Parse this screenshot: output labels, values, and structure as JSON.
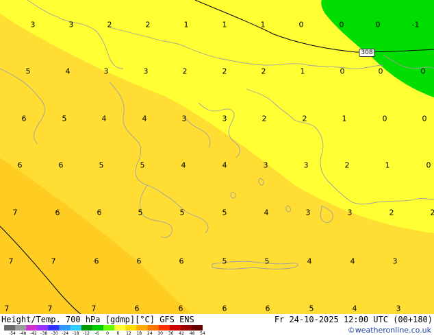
{
  "map": {
    "contour_label": "308",
    "colors": {
      "land_sea": "#ffff33",
      "warm_zone": "#ffdd33",
      "warmer_zone": "#ffcc22",
      "cold_zone": "#00dd00",
      "coastline": "#a0a0a0"
    },
    "temps": [
      "3",
      "3",
      "2",
      "2",
      "1",
      "1",
      "1",
      "0",
      "0",
      "0",
      "-1",
      "5",
      "4",
      "3",
      "3",
      "2",
      "2",
      "2",
      "1",
      "0",
      "0",
      "0",
      "6",
      "5",
      "4",
      "4",
      "3",
      "3",
      "2",
      "2",
      "1",
      "0",
      "0",
      "6",
      "6",
      "5",
      "5",
      "4",
      "4",
      "3",
      "3",
      "2",
      "1",
      "0",
      "7",
      "6",
      "6",
      "5",
      "5",
      "5",
      "4",
      "3",
      "3",
      "2",
      "2",
      "7",
      "7",
      "6",
      "6",
      "6",
      "5",
      "5",
      "4",
      "4",
      "3",
      "7",
      "7",
      "7",
      "6",
      "6",
      "6",
      "6",
      "5",
      "4",
      "3"
    ]
  },
  "footer": {
    "title_left": "Height/Temp. 700 hPa [gdmp][°C] GFS ENS",
    "title_right": "Fr 24-10-2025 12:00 UTC (00+180)",
    "credit": "©weatheronline.co.uk",
    "colorbar_ticks": [
      "-54",
      "-48",
      "-42",
      "-38",
      "-30",
      "-24",
      "-18",
      "-12",
      "-6",
      "0",
      "6",
      "12",
      "18",
      "24",
      "30",
      "36",
      "42",
      "48",
      "54"
    ],
    "colorbar_colors": [
      "#6b6b6b",
      "#9b9b9b",
      "#cc33cc",
      "#9933ff",
      "#3333ff",
      "#3399ff",
      "#33ccff",
      "#009900",
      "#00cc00",
      "#66ff00",
      "#ffff33",
      "#ffdd00",
      "#ffaa00",
      "#ff7700",
      "#ff3300",
      "#cc0000",
      "#990000",
      "#660000"
    ]
  }
}
